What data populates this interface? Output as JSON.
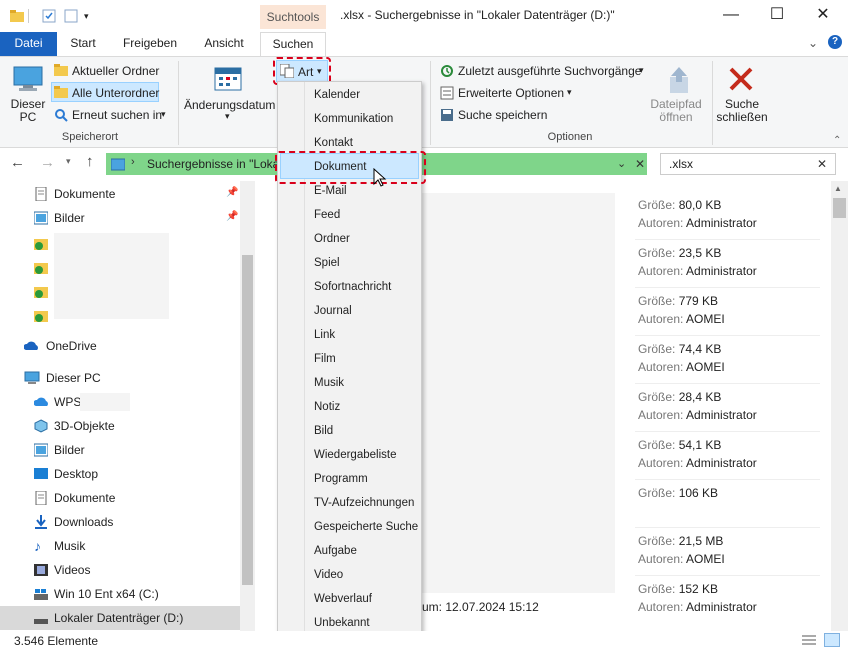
{
  "titlebar": {
    "context_tab": "Suchtools",
    "title": ".xlsx - Suchergebnisse in \"Lokaler Datenträger (D:)\"",
    "minimize": "—",
    "maximize": "☐",
    "close": "✕"
  },
  "tabs": {
    "datei": "Datei",
    "start": "Start",
    "freigeben": "Freigeben",
    "ansicht": "Ansicht",
    "suchen": "Suchen"
  },
  "ribbon": {
    "dieser_pc": "Dieser PC",
    "aktueller_ordner": "Aktueller Ordner",
    "alle_unterordner": "Alle Unterordner",
    "erneut_suchen": "Erneut suchen in",
    "speicherort_label": "Speicherort",
    "aenderungsdatum": "Änderungsdatum",
    "art": "Art",
    "zuletzt": "Zuletzt ausgeführte Suchvorgänge",
    "erweiterte": "Erweiterte Optionen",
    "suche_speichern": "Suche speichern",
    "optionen_label": "Optionen",
    "dateipfad_oeffnen": "Dateipfad öffnen",
    "suche_schliessen": "Suche schließen"
  },
  "address": {
    "path": "Suchergebnisse in \"Loka",
    "search_value": ".xlsx"
  },
  "nav": {
    "dokumente": "Dokumente",
    "bilder": "Bilder",
    "onedrive": "OneDrive",
    "dieser_pc": "Dieser PC",
    "wps": "WPS",
    "objekte": "3D-Objekte",
    "bilder2": "Bilder",
    "desktop": "Desktop",
    "dokumente2": "Dokumente",
    "downloads": "Downloads",
    "musik": "Musik",
    "videos": "Videos",
    "win10": "Win 10 Ent x64 (C:)",
    "lokal": "Lokaler Datenträger (D:)"
  },
  "results": [
    {
      "size_label": "Größe:",
      "size": "80,0 KB",
      "author_label": "Autoren:",
      "author": "Administrator"
    },
    {
      "size_label": "Größe:",
      "size": "23,5 KB",
      "author_label": "Autoren:",
      "author": "Administrator"
    },
    {
      "size_label": "Größe:",
      "size": "779 KB",
      "author_label": "Autoren:",
      "author": "AOMEI"
    },
    {
      "size_label": "Größe:",
      "size": "74,4 KB",
      "author_label": "Autoren:",
      "author": "AOMEI"
    },
    {
      "size_label": "Größe:",
      "size": "28,4 KB",
      "author_label": "Autoren:",
      "author": "Administrator"
    },
    {
      "size_label": "Größe:",
      "size": "54,1 KB",
      "author_label": "Autoren:",
      "author": "Administrator"
    },
    {
      "size_label": "Größe:",
      "size": "106 KB",
      "author_label": "",
      "author": ""
    },
    {
      "size_label": "Größe:",
      "size": "21,5 MB",
      "author_label": "Autoren:",
      "author": "AOMEI"
    },
    {
      "size_label": "Größe:",
      "size": "152 KB",
      "author_label": "Autoren:",
      "author": "Administrator"
    }
  ],
  "partial_date": "um: 12.07.2024 15:12",
  "menu": {
    "items": [
      "Kalender",
      "Kommunikation",
      "Kontakt",
      "Dokument",
      "E-Mail",
      "Feed",
      "Ordner",
      "Spiel",
      "Sofortnachricht",
      "Journal",
      "Link",
      "Film",
      "Musik",
      "Notiz",
      "Bild",
      "Wiedergabeliste",
      "Programm",
      "TV-Aufzeichnungen",
      "Gespeicherte Suche",
      "Aufgabe",
      "Video",
      "Webverlauf",
      "Unbekannt"
    ]
  },
  "status": {
    "count": "3.546 Elemente"
  },
  "colors": {
    "accent": "#1a63c0",
    "highlight": "#d9001b",
    "address_bg": "#7fd58a"
  }
}
